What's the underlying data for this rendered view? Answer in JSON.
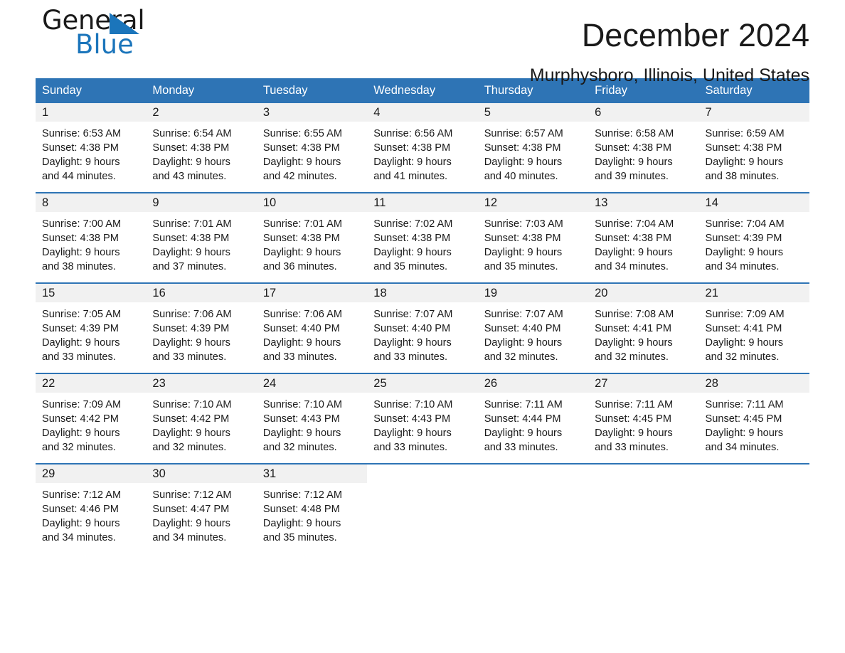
{
  "brand": {
    "name_part1": "General",
    "name_part2": "Blue",
    "logo_icon": "triangle-icon"
  },
  "header": {
    "title": "December 2024",
    "subtitle": "Murphysboro, Illinois, United States"
  },
  "colors": {
    "header_blue": "#2e74b5",
    "brand_blue": "#1b75bb",
    "daynum_band": "#f1f1f1",
    "text": "#1a1a1a"
  },
  "weekdays": [
    "Sunday",
    "Monday",
    "Tuesday",
    "Wednesday",
    "Thursday",
    "Friday",
    "Saturday"
  ],
  "weeks": [
    [
      {
        "day": "1",
        "sunrise": "Sunrise: 6:53 AM",
        "sunset": "Sunset: 4:38 PM",
        "daylight1": "Daylight: 9 hours",
        "daylight2": "and 44 minutes."
      },
      {
        "day": "2",
        "sunrise": "Sunrise: 6:54 AM",
        "sunset": "Sunset: 4:38 PM",
        "daylight1": "Daylight: 9 hours",
        "daylight2": "and 43 minutes."
      },
      {
        "day": "3",
        "sunrise": "Sunrise: 6:55 AM",
        "sunset": "Sunset: 4:38 PM",
        "daylight1": "Daylight: 9 hours",
        "daylight2": "and 42 minutes."
      },
      {
        "day": "4",
        "sunrise": "Sunrise: 6:56 AM",
        "sunset": "Sunset: 4:38 PM",
        "daylight1": "Daylight: 9 hours",
        "daylight2": "and 41 minutes."
      },
      {
        "day": "5",
        "sunrise": "Sunrise: 6:57 AM",
        "sunset": "Sunset: 4:38 PM",
        "daylight1": "Daylight: 9 hours",
        "daylight2": "and 40 minutes."
      },
      {
        "day": "6",
        "sunrise": "Sunrise: 6:58 AM",
        "sunset": "Sunset: 4:38 PM",
        "daylight1": "Daylight: 9 hours",
        "daylight2": "and 39 minutes."
      },
      {
        "day": "7",
        "sunrise": "Sunrise: 6:59 AM",
        "sunset": "Sunset: 4:38 PM",
        "daylight1": "Daylight: 9 hours",
        "daylight2": "and 38 minutes."
      }
    ],
    [
      {
        "day": "8",
        "sunrise": "Sunrise: 7:00 AM",
        "sunset": "Sunset: 4:38 PM",
        "daylight1": "Daylight: 9 hours",
        "daylight2": "and 38 minutes."
      },
      {
        "day": "9",
        "sunrise": "Sunrise: 7:01 AM",
        "sunset": "Sunset: 4:38 PM",
        "daylight1": "Daylight: 9 hours",
        "daylight2": "and 37 minutes."
      },
      {
        "day": "10",
        "sunrise": "Sunrise: 7:01 AM",
        "sunset": "Sunset: 4:38 PM",
        "daylight1": "Daylight: 9 hours",
        "daylight2": "and 36 minutes."
      },
      {
        "day": "11",
        "sunrise": "Sunrise: 7:02 AM",
        "sunset": "Sunset: 4:38 PM",
        "daylight1": "Daylight: 9 hours",
        "daylight2": "and 35 minutes."
      },
      {
        "day": "12",
        "sunrise": "Sunrise: 7:03 AM",
        "sunset": "Sunset: 4:38 PM",
        "daylight1": "Daylight: 9 hours",
        "daylight2": "and 35 minutes."
      },
      {
        "day": "13",
        "sunrise": "Sunrise: 7:04 AM",
        "sunset": "Sunset: 4:38 PM",
        "daylight1": "Daylight: 9 hours",
        "daylight2": "and 34 minutes."
      },
      {
        "day": "14",
        "sunrise": "Sunrise: 7:04 AM",
        "sunset": "Sunset: 4:39 PM",
        "daylight1": "Daylight: 9 hours",
        "daylight2": "and 34 minutes."
      }
    ],
    [
      {
        "day": "15",
        "sunrise": "Sunrise: 7:05 AM",
        "sunset": "Sunset: 4:39 PM",
        "daylight1": "Daylight: 9 hours",
        "daylight2": "and 33 minutes."
      },
      {
        "day": "16",
        "sunrise": "Sunrise: 7:06 AM",
        "sunset": "Sunset: 4:39 PM",
        "daylight1": "Daylight: 9 hours",
        "daylight2": "and 33 minutes."
      },
      {
        "day": "17",
        "sunrise": "Sunrise: 7:06 AM",
        "sunset": "Sunset: 4:40 PM",
        "daylight1": "Daylight: 9 hours",
        "daylight2": "and 33 minutes."
      },
      {
        "day": "18",
        "sunrise": "Sunrise: 7:07 AM",
        "sunset": "Sunset: 4:40 PM",
        "daylight1": "Daylight: 9 hours",
        "daylight2": "and 33 minutes."
      },
      {
        "day": "19",
        "sunrise": "Sunrise: 7:07 AM",
        "sunset": "Sunset: 4:40 PM",
        "daylight1": "Daylight: 9 hours",
        "daylight2": "and 32 minutes."
      },
      {
        "day": "20",
        "sunrise": "Sunrise: 7:08 AM",
        "sunset": "Sunset: 4:41 PM",
        "daylight1": "Daylight: 9 hours",
        "daylight2": "and 32 minutes."
      },
      {
        "day": "21",
        "sunrise": "Sunrise: 7:09 AM",
        "sunset": "Sunset: 4:41 PM",
        "daylight1": "Daylight: 9 hours",
        "daylight2": "and 32 minutes."
      }
    ],
    [
      {
        "day": "22",
        "sunrise": "Sunrise: 7:09 AM",
        "sunset": "Sunset: 4:42 PM",
        "daylight1": "Daylight: 9 hours",
        "daylight2": "and 32 minutes."
      },
      {
        "day": "23",
        "sunrise": "Sunrise: 7:10 AM",
        "sunset": "Sunset: 4:42 PM",
        "daylight1": "Daylight: 9 hours",
        "daylight2": "and 32 minutes."
      },
      {
        "day": "24",
        "sunrise": "Sunrise: 7:10 AM",
        "sunset": "Sunset: 4:43 PM",
        "daylight1": "Daylight: 9 hours",
        "daylight2": "and 32 minutes."
      },
      {
        "day": "25",
        "sunrise": "Sunrise: 7:10 AM",
        "sunset": "Sunset: 4:43 PM",
        "daylight1": "Daylight: 9 hours",
        "daylight2": "and 33 minutes."
      },
      {
        "day": "26",
        "sunrise": "Sunrise: 7:11 AM",
        "sunset": "Sunset: 4:44 PM",
        "daylight1": "Daylight: 9 hours",
        "daylight2": "and 33 minutes."
      },
      {
        "day": "27",
        "sunrise": "Sunrise: 7:11 AM",
        "sunset": "Sunset: 4:45 PM",
        "daylight1": "Daylight: 9 hours",
        "daylight2": "and 33 minutes."
      },
      {
        "day": "28",
        "sunrise": "Sunrise: 7:11 AM",
        "sunset": "Sunset: 4:45 PM",
        "daylight1": "Daylight: 9 hours",
        "daylight2": "and 34 minutes."
      }
    ],
    [
      {
        "day": "29",
        "sunrise": "Sunrise: 7:12 AM",
        "sunset": "Sunset: 4:46 PM",
        "daylight1": "Daylight: 9 hours",
        "daylight2": "and 34 minutes."
      },
      {
        "day": "30",
        "sunrise": "Sunrise: 7:12 AM",
        "sunset": "Sunset: 4:47 PM",
        "daylight1": "Daylight: 9 hours",
        "daylight2": "and 34 minutes."
      },
      {
        "day": "31",
        "sunrise": "Sunrise: 7:12 AM",
        "sunset": "Sunset: 4:48 PM",
        "daylight1": "Daylight: 9 hours",
        "daylight2": "and 35 minutes."
      },
      {
        "day": "",
        "sunrise": "",
        "sunset": "",
        "daylight1": "",
        "daylight2": ""
      },
      {
        "day": "",
        "sunrise": "",
        "sunset": "",
        "daylight1": "",
        "daylight2": ""
      },
      {
        "day": "",
        "sunrise": "",
        "sunset": "",
        "daylight1": "",
        "daylight2": ""
      },
      {
        "day": "",
        "sunrise": "",
        "sunset": "",
        "daylight1": "",
        "daylight2": ""
      }
    ]
  ]
}
